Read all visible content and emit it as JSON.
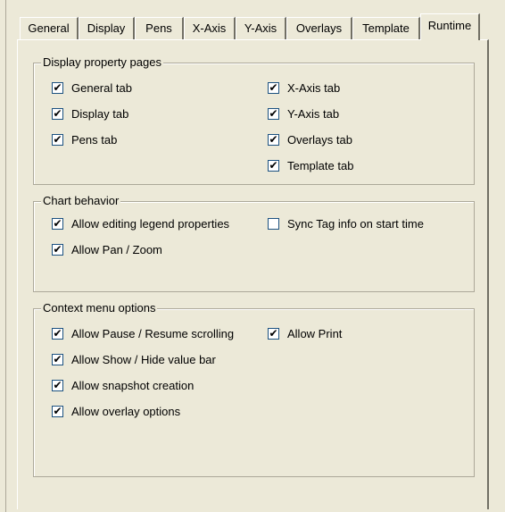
{
  "tabs": [
    {
      "label": "General",
      "active": false
    },
    {
      "label": "Display",
      "active": false
    },
    {
      "label": "Pens",
      "active": false
    },
    {
      "label": "X-Axis",
      "active": false
    },
    {
      "label": "Y-Axis",
      "active": false
    },
    {
      "label": "Overlays",
      "active": false
    },
    {
      "label": "Template",
      "active": false
    },
    {
      "label": "Runtime",
      "active": true
    }
  ],
  "groups": {
    "display_pages": {
      "title": "Display property pages",
      "items": [
        {
          "label": "General tab",
          "checked": true
        },
        {
          "label": "Display tab",
          "checked": true
        },
        {
          "label": "Pens tab",
          "checked": true
        },
        {
          "label": "X-Axis tab",
          "checked": true
        },
        {
          "label": "Y-Axis tab",
          "checked": true
        },
        {
          "label": "Overlays tab",
          "checked": true
        },
        {
          "label": "Template tab",
          "checked": true
        }
      ]
    },
    "chart_behavior": {
      "title": "Chart behavior",
      "items": [
        {
          "label": "Allow editing legend properties",
          "checked": true
        },
        {
          "label": "Allow Pan / Zoom",
          "checked": true
        },
        {
          "label": "Sync Tag info on start time",
          "checked": false
        }
      ]
    },
    "context_menu": {
      "title": "Context menu options",
      "items": [
        {
          "label": "Allow Pause / Resume scrolling",
          "checked": true
        },
        {
          "label": "Allow Show / Hide value bar",
          "checked": true
        },
        {
          "label": "Allow snapshot creation",
          "checked": true
        },
        {
          "label": "Allow overlay options",
          "checked": true
        },
        {
          "label": "Allow Print",
          "checked": true
        }
      ]
    }
  },
  "check_glyph": "✔"
}
